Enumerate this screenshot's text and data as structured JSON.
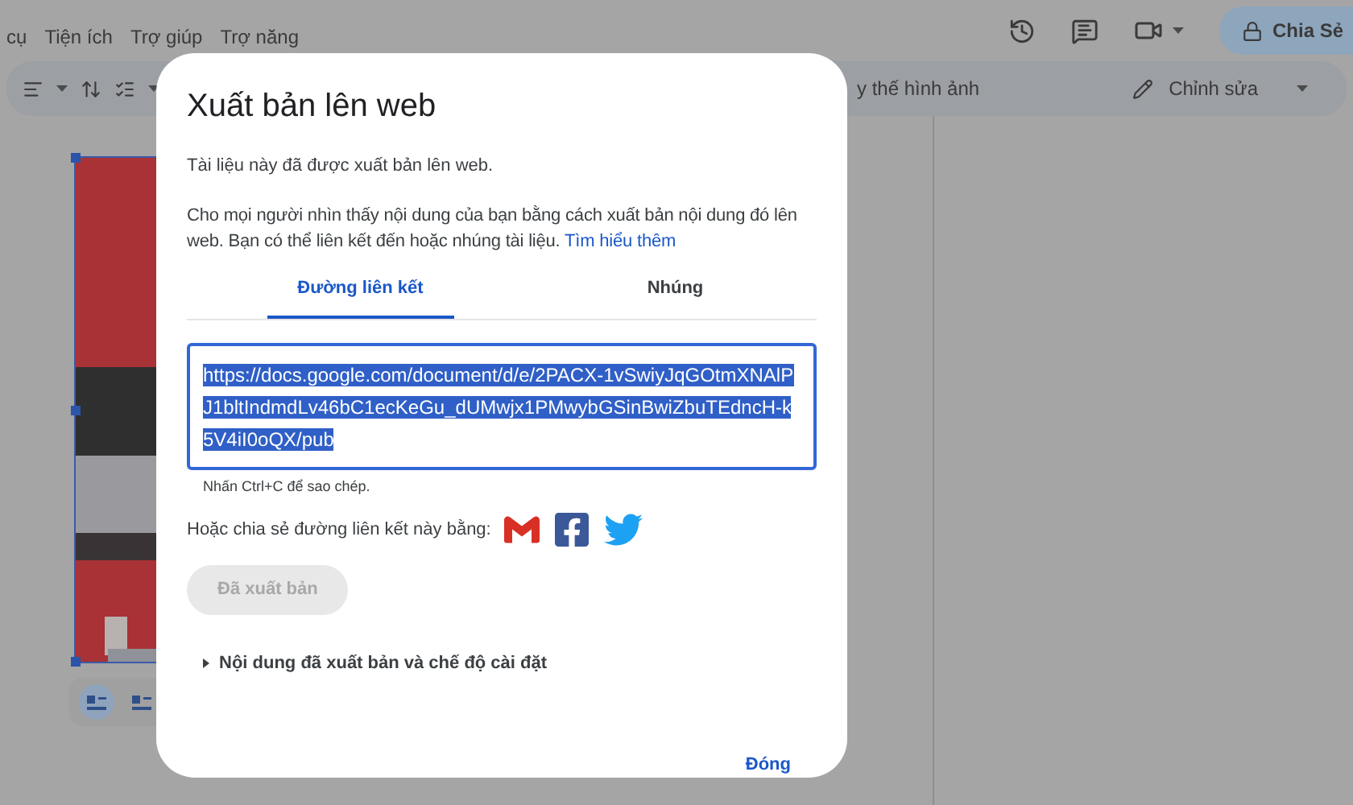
{
  "menu": [
    "cụ",
    "Tiện ích",
    "Trợ giúp",
    "Trợ năng"
  ],
  "share_button": {
    "label": "Chia Sẻ"
  },
  "toolbar": {
    "image_option": "y thế hình ảnh",
    "mode": "Chỉnh sửa"
  },
  "image_layout_options": [
    {
      "selected": true
    },
    {
      "selected": false
    }
  ],
  "dialog": {
    "title": "Xuất bản lên web",
    "status": "Tài liệu này đã được xuất bản lên web.",
    "description": "Cho mọi người nhìn thấy nội dung của bạn bằng cách xuất bản nội dung đó lên web. Bạn có thể liên kết đến hoặc nhúng tài liệu.",
    "learn_more": "Tìm hiểu thêm",
    "tabs": [
      {
        "label": "Đường liên kết",
        "selected": true
      },
      {
        "label": "Nhúng",
        "selected": false
      }
    ],
    "link_field": {
      "value": "https://docs.google.com/document/d/e/2PACX-1vSwiyJqGOtmXNAlPJ1bltIndmdLv46bC1ecKeGu_dUMwjx1PMwybGSinBwiZbuTEdncH-k5V4iI0oQX/pub",
      "selected": true
    },
    "hint": "Nhấn Ctrl+C để sao chép.",
    "share_label": "Hoặc chia sẻ đường liên kết này bằng:",
    "publish_button": {
      "label": "Đã xuất bản",
      "disabled": true
    },
    "expander": {
      "label": "Nội dung đã xuất bản và chế độ cài đặt",
      "expanded": false
    },
    "close_button": "Đóng"
  }
}
